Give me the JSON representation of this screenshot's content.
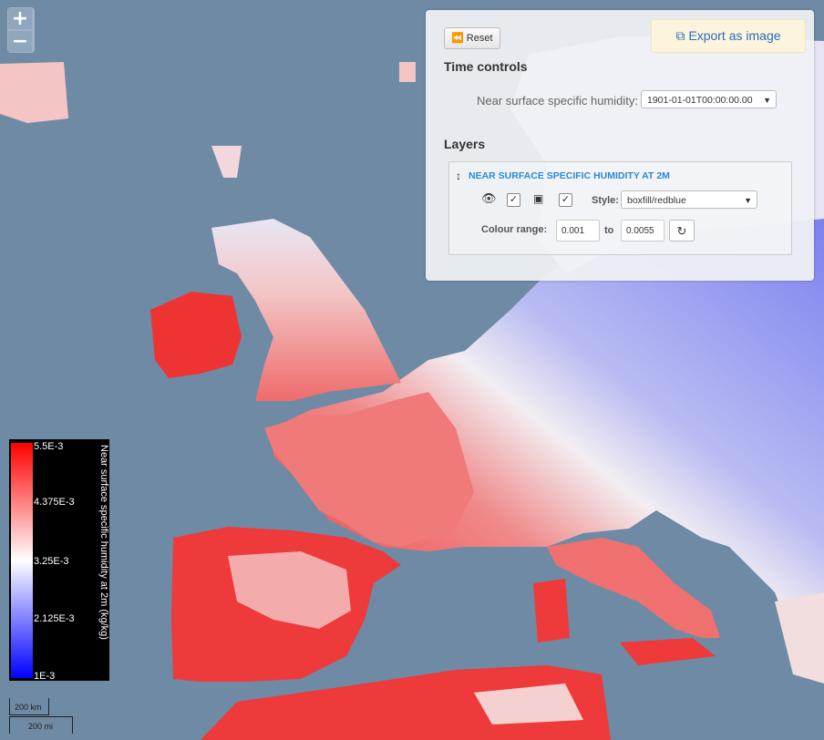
{
  "zoom": {
    "in_label": "+",
    "out_label": "−"
  },
  "panel": {
    "reset_label": "Reset",
    "export_label": "Export as image",
    "time_controls_heading": "Time controls",
    "time_variable_label": "Near surface specific humidity:",
    "time_selected": "1901-01-01T00:00:00.00",
    "layers_heading": "Layers",
    "layer": {
      "title": "NEAR SURFACE SPECIFIC HUMIDITY AT 2M",
      "style_label": "Style:",
      "style_value": "boxfill/redblue",
      "colour_range_label": "Colour range:",
      "range_min": "0.001",
      "range_to": "to",
      "range_max": "0.0055"
    }
  },
  "legend": {
    "title": "Near surface specific humidity at 2m (kg/kg)",
    "ticks": [
      "5.5E-3",
      "4.375E-3",
      "3.25E-3",
      "2.125E-3",
      "1E-3"
    ],
    "colors": {
      "max": "#ff0000",
      "mid": "#ffffff",
      "min": "#0000ff"
    }
  },
  "scale": {
    "metric": "200 km",
    "imperial": "200 mi"
  },
  "map": {
    "sea_color": "#6f8aa5",
    "ocean_note_hidden": ""
  }
}
